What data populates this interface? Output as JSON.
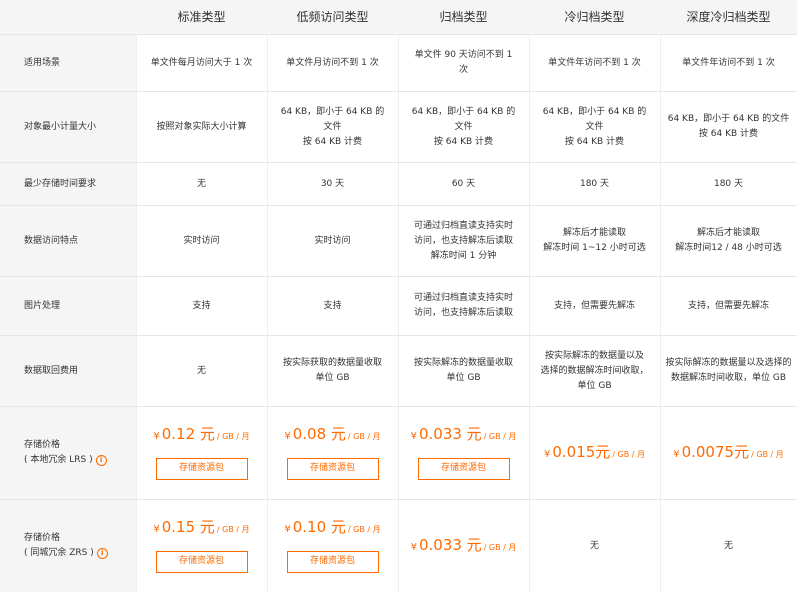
{
  "headers": [
    "",
    "标准类型",
    "低频访问类型",
    "归档类型",
    "冷归档类型",
    "深度冷归档类型"
  ],
  "rows": [
    {
      "label": "适用场景",
      "cells": [
        "单文件每月访问大于 1 次",
        "单文件月访问不到 1 次",
        "单文件 90 天访问不到 1\n次",
        "单文件年访问不到 1 次",
        "单文件年访问不到 1 次"
      ]
    },
    {
      "label": "对象最小计量大小",
      "cells": [
        "按照对象实际大小计算",
        "64 KB，即小于 64 KB 的\n文件\n按 64 KB 计费",
        "64 KB，即小于 64 KB 的\n文件\n按 64 KB 计费",
        "64 KB，即小于 64 KB 的\n文件\n按 64 KB 计费",
        "64 KB，即小于 64 KB 的文件\n按 64 KB 计费"
      ]
    },
    {
      "label": "最少存储时间要求",
      "cells": [
        "无",
        "30 天",
        "60 天",
        "180 天",
        "180 天"
      ]
    },
    {
      "label": "数据访问特点",
      "cells": [
        "实时访问",
        "实时访问",
        "可通过归档直读支持实时\n访问，也支持解冻后读取\n解冻时间 1 分钟",
        "解冻后才能读取\n解冻时间 1~12 小时可选",
        "解冻后才能读取\n解冻时间12 / 48 小时可选"
      ]
    },
    {
      "label": "图片处理",
      "cells": [
        "支持",
        "支持",
        "可通过归档直读支持实时\n访问，也支持解冻后读取",
        "支持，但需要先解冻",
        "支持，但需要先解冻"
      ]
    },
    {
      "label": "数据取回费用",
      "cells": [
        "无",
        "按实际获取的数据量收取\n单位 GB",
        "按实际解冻的数据量收取\n单位 GB",
        "按实际解冻的数据量以及\n选择的数据解冻时间收取，\n单位 GB",
        "按实际解冻的数据量以及选择的\n数据解冻时间收取，单位 GB"
      ]
    }
  ],
  "lrs": {
    "label1": "存储价格",
    "label2": "( 本地冗余 LRS )",
    "prices": [
      {
        "currency": "¥",
        "amount": "0.12 元",
        "unit": "/ GB / 月",
        "button": "存储资源包"
      },
      {
        "currency": "¥",
        "amount": "0.08 元",
        "unit": "/ GB / 月",
        "button": "存储资源包"
      },
      {
        "currency": "¥",
        "amount": "0.033 元",
        "unit": "/ GB / 月",
        "button": "存储资源包"
      },
      {
        "currency": "¥",
        "amount": "0.015元",
        "unit": "/ GB / 月",
        "button": ""
      },
      {
        "currency": "¥",
        "amount": "0.0075元",
        "unit": "/ GB / 月",
        "button": ""
      }
    ]
  },
  "zrs": {
    "label1": "存储价格",
    "label2": "( 同城冗余 ZRS )",
    "prices": [
      {
        "currency": "¥",
        "amount": "0.15 元",
        "unit": "/ GB / 月",
        "button": "存储资源包"
      },
      {
        "currency": "¥",
        "amount": "0.10 元",
        "unit": "/ GB / 月",
        "button": "存储资源包"
      },
      {
        "currency": "¥",
        "amount": "0.033 元",
        "unit": "/ GB / 月",
        "button": ""
      },
      {
        "currency": "",
        "amount": "无",
        "unit": "",
        "button": ""
      },
      {
        "currency": "",
        "amount": "无",
        "unit": "",
        "button": ""
      }
    ]
  },
  "info_icon": "info-circle-icon",
  "accent_color": "#ff6a00"
}
